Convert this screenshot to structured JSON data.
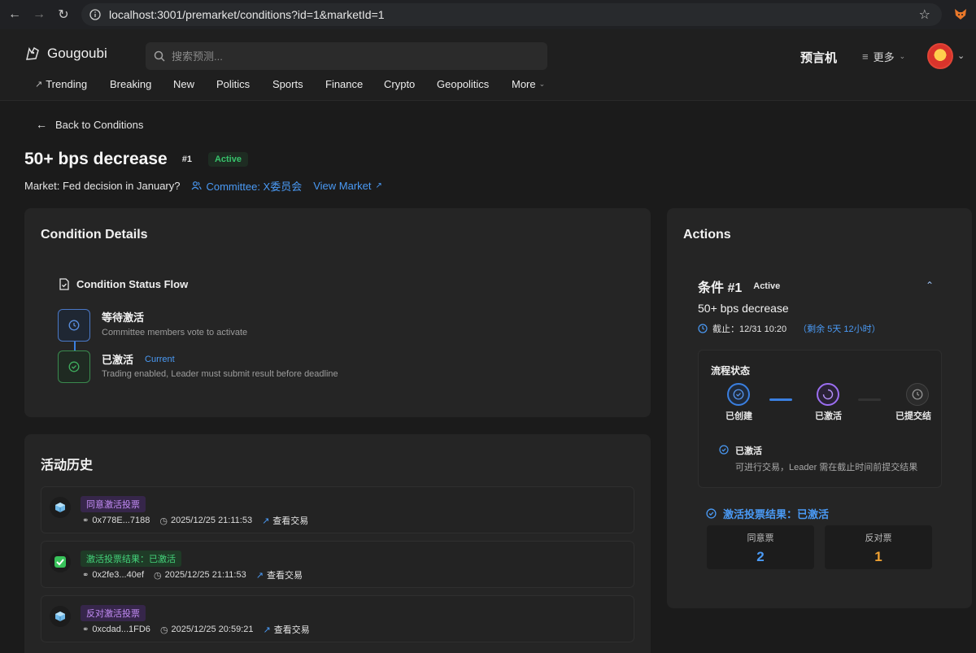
{
  "browser": {
    "url": "localhost:3001/premarket/conditions?id=1&marketId=1"
  },
  "header": {
    "logo": "Gougoubi",
    "search_placeholder": "搜索预测...",
    "yuyanji": "预言机",
    "more": "更多",
    "nav": [
      "Trending",
      "Breaking",
      "New",
      "Politics",
      "Sports",
      "Finance",
      "Crypto",
      "Geopolitics",
      "More"
    ]
  },
  "page": {
    "back": "Back to Conditions",
    "title": "50+ bps decrease",
    "number": "#1",
    "status": "Active",
    "market": "Market: Fed decision in January?",
    "committee": "Committee: X委员会",
    "view_market": "View Market"
  },
  "condition_details": {
    "title": "Condition Details",
    "flow_title": "Condition Status Flow",
    "steps": [
      {
        "name": "等待激活",
        "desc": "Committee members vote to activate"
      },
      {
        "name": "已激活",
        "badge": "Current",
        "desc": "Trading enabled, Leader must submit result before deadline"
      }
    ]
  },
  "activity": {
    "title": "活动历史",
    "items": [
      {
        "icon": "cube-icon",
        "tag": "同意激活投票",
        "tag_color": "#c38cf5",
        "address": "0x778E...7188",
        "time": "2025/12/25 21:11:53",
        "link": "查看交易"
      },
      {
        "icon": "check-icon",
        "tag": "激活投票结果：已激活",
        "tag_color": "#44d27a",
        "address": "0x2fe3...40ef",
        "time": "2025/12/25 21:11:53",
        "link": "查看交易"
      },
      {
        "icon": "cube-icon",
        "tag": "反对激活投票",
        "tag_color": "#c38cf5",
        "address": "0xcdad...1FD6",
        "time": "2025/12/25 20:59:21",
        "link": "查看交易"
      }
    ]
  },
  "actions": {
    "title": "Actions",
    "condition_label": "条件 #1",
    "condition_status": "Active",
    "condition_name": "50+ bps decrease",
    "deadline": "截止：12/31 10:20",
    "remaining": "（剩余 5天 12小时）",
    "flow": {
      "title": "流程状态",
      "nodes": [
        "已创建",
        "已激活",
        "已提交结"
      ],
      "status_title": "已激活",
      "status_desc": "可进行交易，Leader 需在截止时间前提交结果"
    },
    "vote_result": "激活投票结果：已激活",
    "votes": [
      {
        "label": "同意票",
        "value": "2",
        "color": "#4a9af5"
      },
      {
        "label": "反对票",
        "value": "1",
        "color": "#f0a232"
      }
    ]
  }
}
